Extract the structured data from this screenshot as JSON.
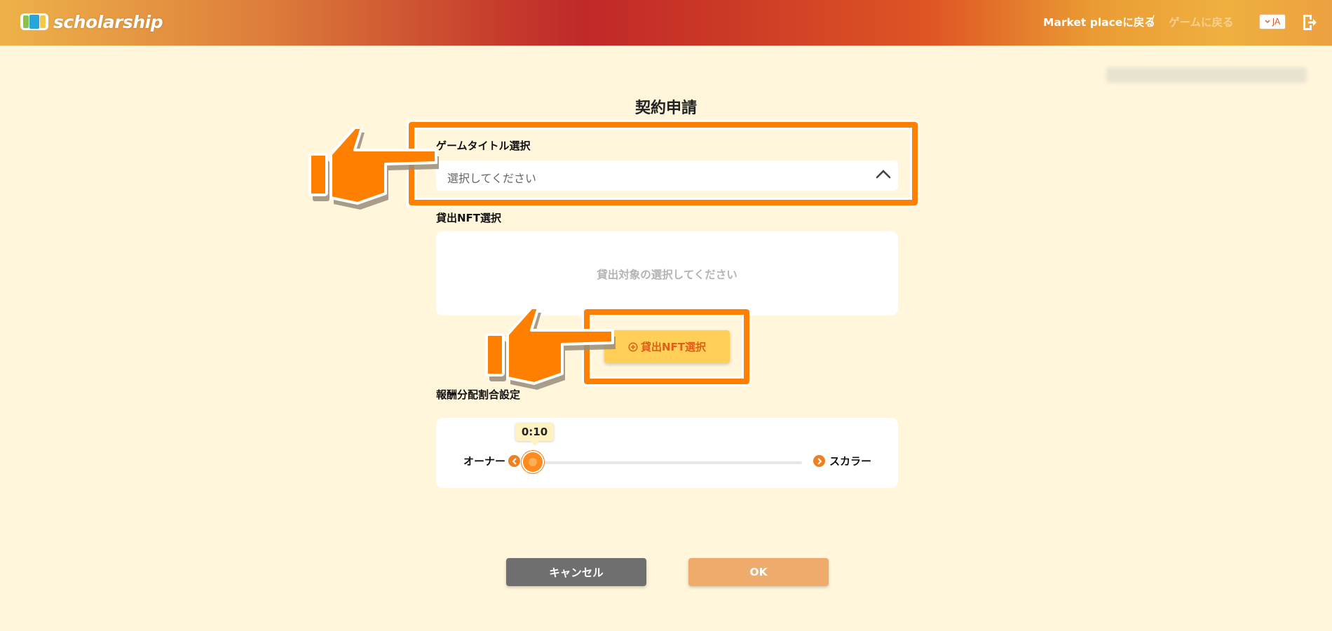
{
  "header": {
    "logo_text": "scholarship",
    "nav_market": "Market placeに戻る",
    "nav_separator": "/",
    "nav_game": "ゲームに戻る",
    "language": "JA",
    "icons": [
      "logo-mark",
      "chevron-down-icon",
      "logout-icon"
    ]
  },
  "form": {
    "title": "契約申請",
    "game_title_label": "ゲームタイトル選択",
    "game_title_placeholder": "選択してください",
    "nft_label": "貸出NFT選択",
    "nft_empty_text": "貸出対象の選択してください",
    "nft_button_label": "貸出NFT選択",
    "reward_label": "報酬分配割合設定",
    "owner_label": "オーナー",
    "scholar_label": "スカラー",
    "ratio_value": "0:10",
    "slider_position": 0
  },
  "actions": {
    "cancel_label": "キャンセル",
    "ok_label": "OK"
  },
  "colors": {
    "accent": "#ff7f00",
    "background": "#fff6dc",
    "cancel": "#6f6f6f",
    "ok": "#efab6b",
    "nft_button": "#ffcf57"
  }
}
